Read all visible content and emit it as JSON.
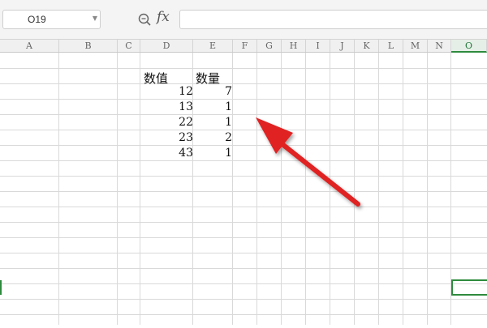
{
  "formula_bar": {
    "name_box": "O19",
    "fx_label": "fx",
    "formula": ""
  },
  "columns": [
    "A",
    "B",
    "C",
    "D",
    "E",
    "F",
    "G",
    "H",
    "I",
    "J",
    "K",
    "L",
    "M",
    "N",
    "O"
  ],
  "active_column": "O",
  "table": {
    "headers": [
      "数值",
      "数量"
    ],
    "rows": [
      [
        "12",
        "7"
      ],
      [
        "13",
        "1"
      ],
      [
        "22",
        "1"
      ],
      [
        "23",
        "2"
      ],
      [
        "43",
        "1"
      ]
    ]
  },
  "selected_cell": "O19",
  "colors": {
    "selection": "#2e8b3d",
    "arrow": "#e02020",
    "gridline": "#d9d9d9",
    "header_bg": "#f0f0f0"
  },
  "icons": {
    "zoom": "zoom-magnifier-icon",
    "function": "fx-icon",
    "dropdown": "chevron-down-icon"
  }
}
